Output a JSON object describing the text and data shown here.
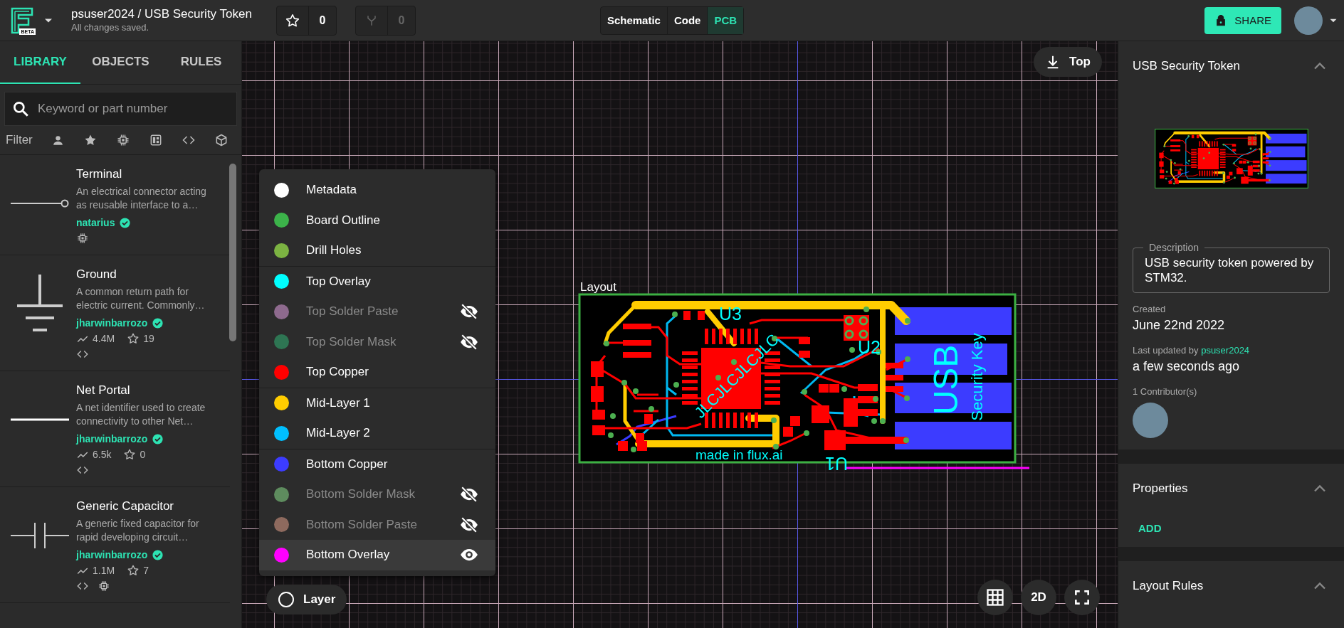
{
  "topbar": {
    "logo_badge": "BETA",
    "project": "psuser2024 / USB Security Token",
    "status": "All changes saved.",
    "star_count": "0",
    "fork_count": "0",
    "views": [
      {
        "label": "Schematic",
        "selected": false
      },
      {
        "label": "Code",
        "selected": false
      },
      {
        "label": "PCB",
        "selected": true
      }
    ],
    "share": "SHARE"
  },
  "sidebar": {
    "tabs": [
      {
        "label": "LIBRARY",
        "selected": true
      },
      {
        "label": "OBJECTS",
        "selected": false
      },
      {
        "label": "RULES",
        "selected": false
      }
    ],
    "search": {
      "placeholder": "Keyword or part number"
    },
    "filter_label": "Filter",
    "parts": [
      {
        "kind": "terminal",
        "name": "Terminal",
        "description": "An electrical connector acting as reusable interface to a…",
        "author": "natarius",
        "verified": true,
        "badges": [
          {
            "kind": "chip"
          }
        ]
      },
      {
        "kind": "ground",
        "name": "Ground",
        "description": "A common return path for electric current. Commonly…",
        "author": "jharwinbarrozo",
        "verified": true,
        "uses": "4.4M",
        "star_count": "19",
        "badges": [
          {
            "kind": "code"
          }
        ]
      },
      {
        "kind": "net-portal",
        "name": "Net Portal",
        "description": "A net identifier used to create connectivity to other Net…",
        "author": "jharwinbarrozo",
        "verified": true,
        "uses": "6.5k",
        "star_count": "0",
        "badges": [
          {
            "kind": "code"
          }
        ]
      },
      {
        "kind": "capacitor",
        "name": "Generic Capacitor",
        "description": "A generic fixed capacitor for rapid developing circuit…",
        "author": "jharwinbarrozo",
        "verified": true,
        "uses": "1.1M",
        "star_count": "7",
        "badges": [
          {
            "kind": "code"
          },
          {
            "kind": "chip"
          }
        ]
      }
    ]
  },
  "canvas": {
    "view_button": "Top",
    "board_label": "Layout",
    "board_texts": [
      "U3",
      "JLCJLCJLCJLC",
      "U2",
      "USB",
      "Security Key",
      "made in flux.ai",
      "U1"
    ],
    "layer_groups": [
      {
        "layers": [
          {
            "name": "Metadata",
            "color": "#ffffff",
            "visible": true,
            "hovered": false
          },
          {
            "name": "Board Outline",
            "color": "#3cb34a",
            "visible": true,
            "hovered": false
          },
          {
            "name": "Drill Holes",
            "color": "#7cb342",
            "visible": true,
            "hovered": false
          }
        ]
      },
      {
        "layers": [
          {
            "name": "Top Overlay",
            "color": "#00ffff",
            "visible": true,
            "hovered": false
          },
          {
            "name": "Top Solder Paste",
            "color": "#8e6a8e",
            "visible": false,
            "hovered": false
          },
          {
            "name": "Top Solder Mask",
            "color": "#2e7553",
            "visible": false,
            "hovered": false
          },
          {
            "name": "Top Copper",
            "color": "#ff0000",
            "visible": true,
            "hovered": false
          }
        ]
      },
      {
        "layers": [
          {
            "name": "Mid-Layer 1",
            "color": "#ffcc00",
            "visible": true,
            "hovered": false
          },
          {
            "name": "Mid-Layer 2",
            "color": "#00bfff",
            "visible": true,
            "hovered": false
          }
        ]
      },
      {
        "layers": [
          {
            "name": "Bottom Copper",
            "color": "#3c3cff",
            "visible": true,
            "hovered": false
          },
          {
            "name": "Bottom Solder Mask",
            "color": "#5e8c5e",
            "visible": false,
            "hovered": false
          },
          {
            "name": "Bottom Solder Paste",
            "color": "#8e6a5e",
            "visible": false,
            "hovered": false
          },
          {
            "name": "Bottom Overlay",
            "color": "#ff00ff",
            "visible": true,
            "hovered": true
          }
        ]
      }
    ],
    "layer_button": "Layer",
    "mode_button": "2D"
  },
  "inspector": {
    "title": "USB Security Token",
    "expanded": true,
    "description_label": "Description",
    "description": "USB security token powered by STM32.",
    "created_label": "Created",
    "created": "June 22nd 2022",
    "updated_label": "Last updated by",
    "updated_by": "psuser2024",
    "updated": "a few seconds ago",
    "contributors_label": "1 Contributor(s)",
    "sections": [
      {
        "title": "Properties",
        "expanded": true,
        "action": "ADD"
      },
      {
        "title": "Layout Rules",
        "expanded": true
      }
    ]
  }
}
